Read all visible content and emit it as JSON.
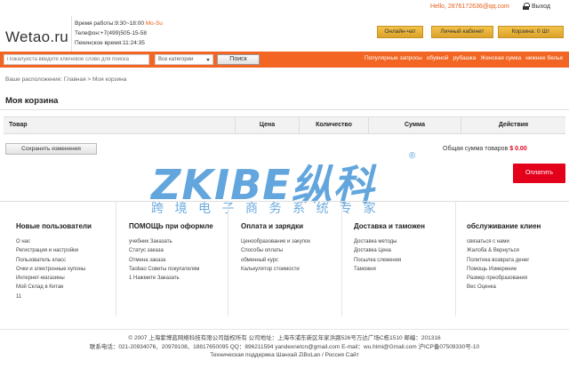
{
  "top": {
    "hello": "Hello, 2876172636@qq.com",
    "logout": "Выход"
  },
  "header": {
    "logo": "Wetao.ru",
    "hours_label": "Время работы:9:30~18:00 ",
    "hours_days": "Mo-Su",
    "phone": "Телефон:+7(499)505-15-58",
    "beijing_time": "Пекинское время:11:24:35",
    "chat_button": "Онлайн-чат",
    "cabinet_button": "Личный кабинет",
    "cart_button": "Корзина: 0 Шт"
  },
  "search": {
    "placeholder": "Пожалуйста введите ключевое слово для поиска",
    "category": "Все категории",
    "button": "Поиск",
    "popular": [
      "Популярные запросы",
      "обувной",
      "рубашка",
      "Женская сумка",
      "нижнее белье"
    ]
  },
  "breadcrumb": "Ваше расположение: Главная > Моя корзина",
  "page_title": "Моя корзина",
  "table": {
    "headers": [
      "Товар",
      "Цена",
      "Количество",
      "Сумма",
      "Действия"
    ]
  },
  "save_button": "Сохранить изменения",
  "total": {
    "label": "Общая сумма товаров",
    "amount": "$ 0.00"
  },
  "pay_button": "Оплатить",
  "watermark": {
    "main": "ZKIBE纵科",
    "reg": "®",
    "cn": "跨境电子商务系统专家"
  },
  "footer": {
    "columns": [
      {
        "title": "Новые пользователи",
        "links": [
          "О нас",
          "Регистрация и настройки",
          "Пользователь класс",
          "Очки и электронные купоны",
          "Интернет-магазины",
          "Мой Склад в Китае",
          "11"
        ]
      },
      {
        "title": "ПОМОЩЬ при оформле",
        "links": [
          "учебник Заказать",
          "Статус заказа",
          "Отмена заказа",
          "Taobao Советы покупателям",
          "1 Нажмите Заказать"
        ]
      },
      {
        "title": "Оплата и зарядки",
        "links": [
          "Ценообразование и закупок",
          "Способы оплаты",
          "обменный курс",
          "Калькулятор стоимости"
        ]
      },
      {
        "title": "Доставка и таможен",
        "links": [
          "Доставка методы",
          "Доставка Цена",
          "Посылка слежения",
          "Таможня"
        ]
      },
      {
        "title": "обслуживание клиен",
        "links": [
          "связаться с нами",
          "Жалоба & Вернуться",
          "Политика возврата денег",
          "Помощь Измерение",
          "Размер преобразования",
          "Вес Оценка"
        ]
      }
    ],
    "copyright_lines": [
      "© 2007 上海紫博蓝网络科技有限公司版权所有     公司地址：上海市浦东新区年家浜路526号万达广场C栋1510     邮编：201316",
      "联系电话：021-20934076、20978108、18817650095     QQ：896211594     yandexnetcn@gmail.com  E-mail：wu.himi@Gmail.com     沪ICP备07509330号-10",
      "Техническая поддержка Шанхай ZiBoLan / Россия Сайт"
    ]
  }
}
